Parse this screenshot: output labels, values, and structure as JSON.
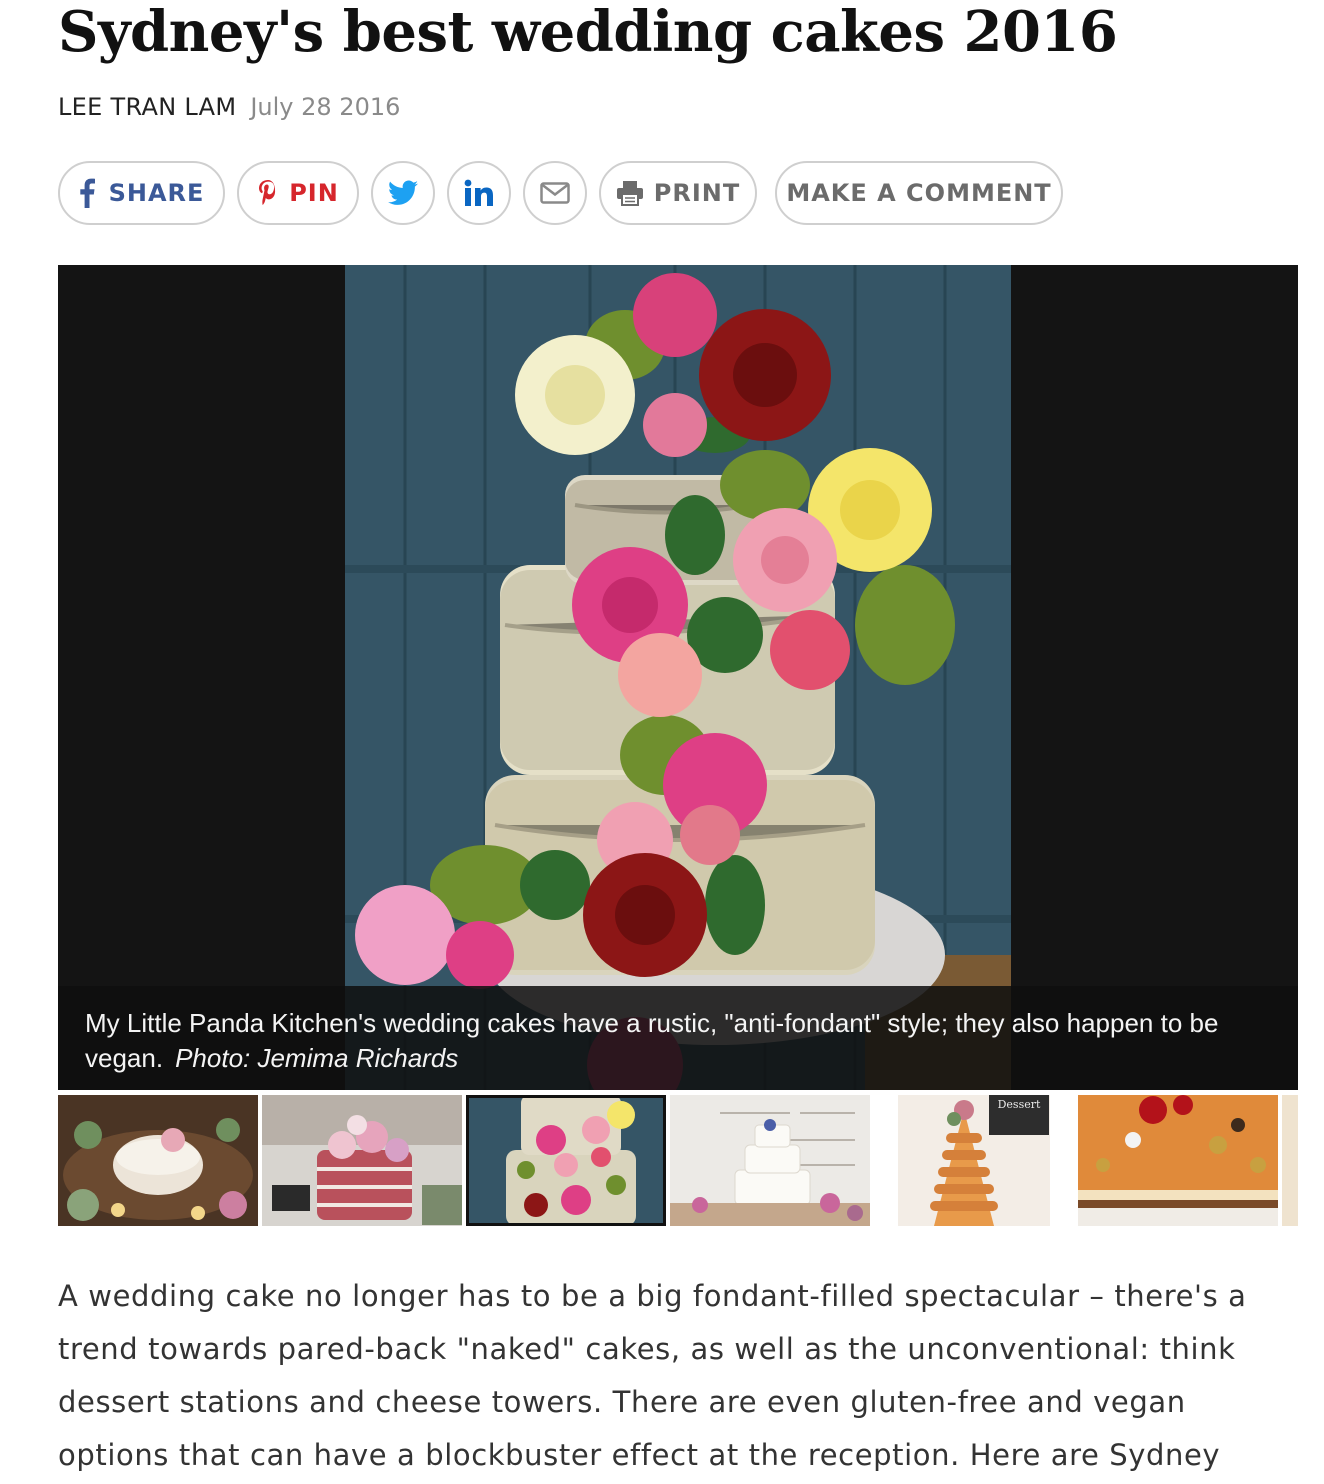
{
  "article": {
    "title": "Sydney's best wedding cakes 2016",
    "author": "LEE TRAN LAM",
    "date": "July 28 2016"
  },
  "share_bar": {
    "facebook_label": "SHARE",
    "pinterest_label": "PIN",
    "print_label": "PRINT",
    "comment_label": "MAKE A COMMENT",
    "icons": [
      "facebook-icon",
      "pinterest-icon",
      "twitter-icon",
      "linkedin-icon",
      "email-icon",
      "print-icon"
    ],
    "colors": {
      "facebook": "#3b5998",
      "pinterest": "#d6262c",
      "twitter": "#1da1f2",
      "linkedin": "#0a66c2",
      "neutral": "#6b6b6b"
    }
  },
  "gallery": {
    "caption_text": "My Little Panda Kitchen's wedding cakes have a rustic, \"anti-fondant\" style; they also happen to be vegan.",
    "caption_credit": "Photo: Jemima Richards",
    "active_index": 2,
    "thumbnails": [
      {
        "name": "thumb-cake-table"
      },
      {
        "name": "thumb-red-velvet-naked-cake"
      },
      {
        "name": "thumb-flower-naked-cake"
      },
      {
        "name": "thumb-white-tiered-cake"
      },
      {
        "name": "thumb-macaron-tower"
      },
      {
        "name": "thumb-dessert-slice"
      }
    ],
    "thumb_text_dessert": "Dessert"
  },
  "body": {
    "intro": "A wedding cake no longer has to be a big fondant-filled spectacular – there's a trend towards pared-back \"naked\" cakes, as well as the unconventional: think dessert stations and cheese towers. There are even gluten-free and vegan options that can have a blockbuster effect at the reception. Here are Sydney"
  }
}
